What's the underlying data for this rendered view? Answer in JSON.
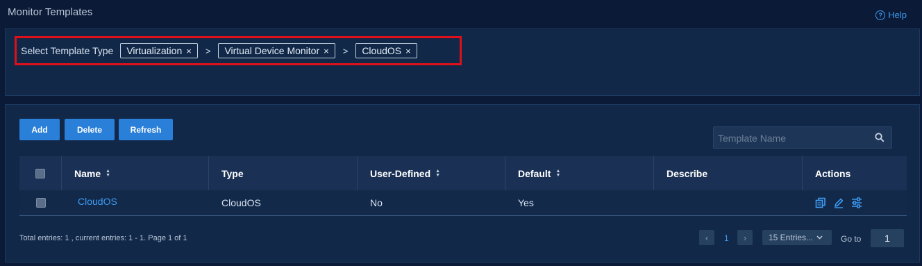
{
  "page": {
    "title": "Monitor Templates",
    "help_label": "Help"
  },
  "filter": {
    "label": "Select Template Type",
    "tags": [
      "Virtualization",
      "Virtual Device Monitor",
      "CloudOS"
    ],
    "separator": ">",
    "remove_glyph": "×"
  },
  "toolbar": {
    "add_label": "Add",
    "delete_label": "Delete",
    "refresh_label": "Refresh"
  },
  "search": {
    "placeholder": "Template Name",
    "icon": "search-icon"
  },
  "table": {
    "columns": [
      "Name",
      "Type",
      "User-Defined",
      "Default",
      "Describe",
      "Actions"
    ],
    "rows": [
      {
        "name": "CloudOS",
        "type": "CloudOS",
        "user_defined": "No",
        "default": "Yes",
        "describe": "",
        "actions": [
          "copy-icon",
          "edit-icon",
          "settings-sliders-icon"
        ]
      }
    ]
  },
  "footer": {
    "summary": "Total entries: 1 , current entries: 1 - 1. Page 1 of 1",
    "prev_glyph": "‹",
    "next_glyph": "›",
    "current_page": "1",
    "page_size_label": "15 Entries...",
    "goto_label": "Go to",
    "goto_value": "1"
  },
  "colors": {
    "accent": "#2a7fd9",
    "link": "#3d9cf3",
    "highlight_border": "#e0101a",
    "background": "#0b1a36",
    "panel": "#112848"
  }
}
